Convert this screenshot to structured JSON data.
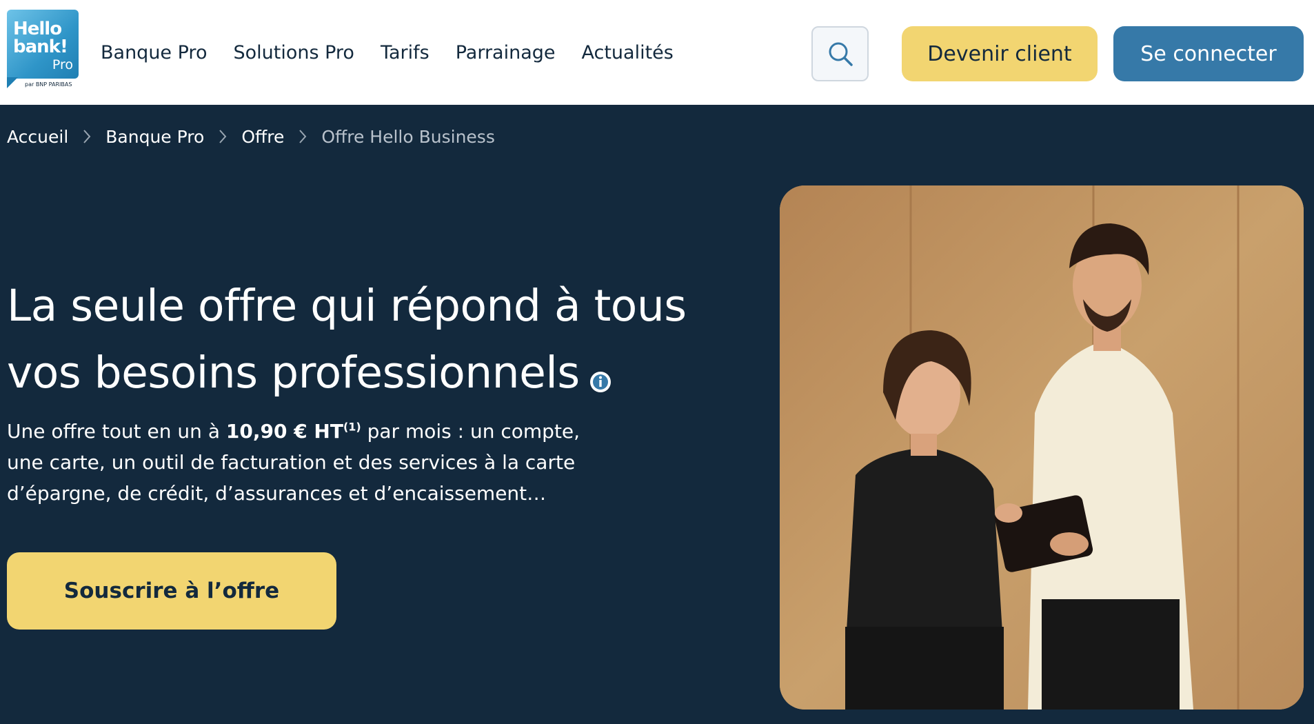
{
  "header": {
    "logo": {
      "line1": "Hello",
      "line2": "bank!",
      "pro": "Pro",
      "sub": "par BNP PARIBAS"
    },
    "nav": [
      {
        "label": "Banque Pro"
      },
      {
        "label": "Solutions Pro"
      },
      {
        "label": "Tarifs"
      },
      {
        "label": "Parrainage"
      },
      {
        "label": "Actualités"
      }
    ],
    "search_icon": "search-icon",
    "become_client_label": "Devenir client",
    "login_label": "Se connecter"
  },
  "breadcrumb": [
    {
      "label": "Accueil"
    },
    {
      "label": "Banque Pro"
    },
    {
      "label": "Offre"
    },
    {
      "label": "Offre Hello Business"
    }
  ],
  "hero": {
    "title_line1": "La seule offre qui répond à tous",
    "title_line2": "vos besoins professionnels",
    "desc_part1": "Une offre tout en un à ",
    "desc_price": "10,90 € HT",
    "desc_sup": "(1)",
    "desc_part2": " par mois : un compte,",
    "desc_line2": "une carte, un outil de facturation et des services à la carte",
    "desc_line3": "d’épargne, de crédit, d’assurances et d’encaissement…",
    "cta_label": "Souscrire à l’offre"
  },
  "colors": {
    "navy": "#13293d",
    "yellow": "#f2d571",
    "blue": "#3679a8",
    "white": "#ffffff"
  }
}
